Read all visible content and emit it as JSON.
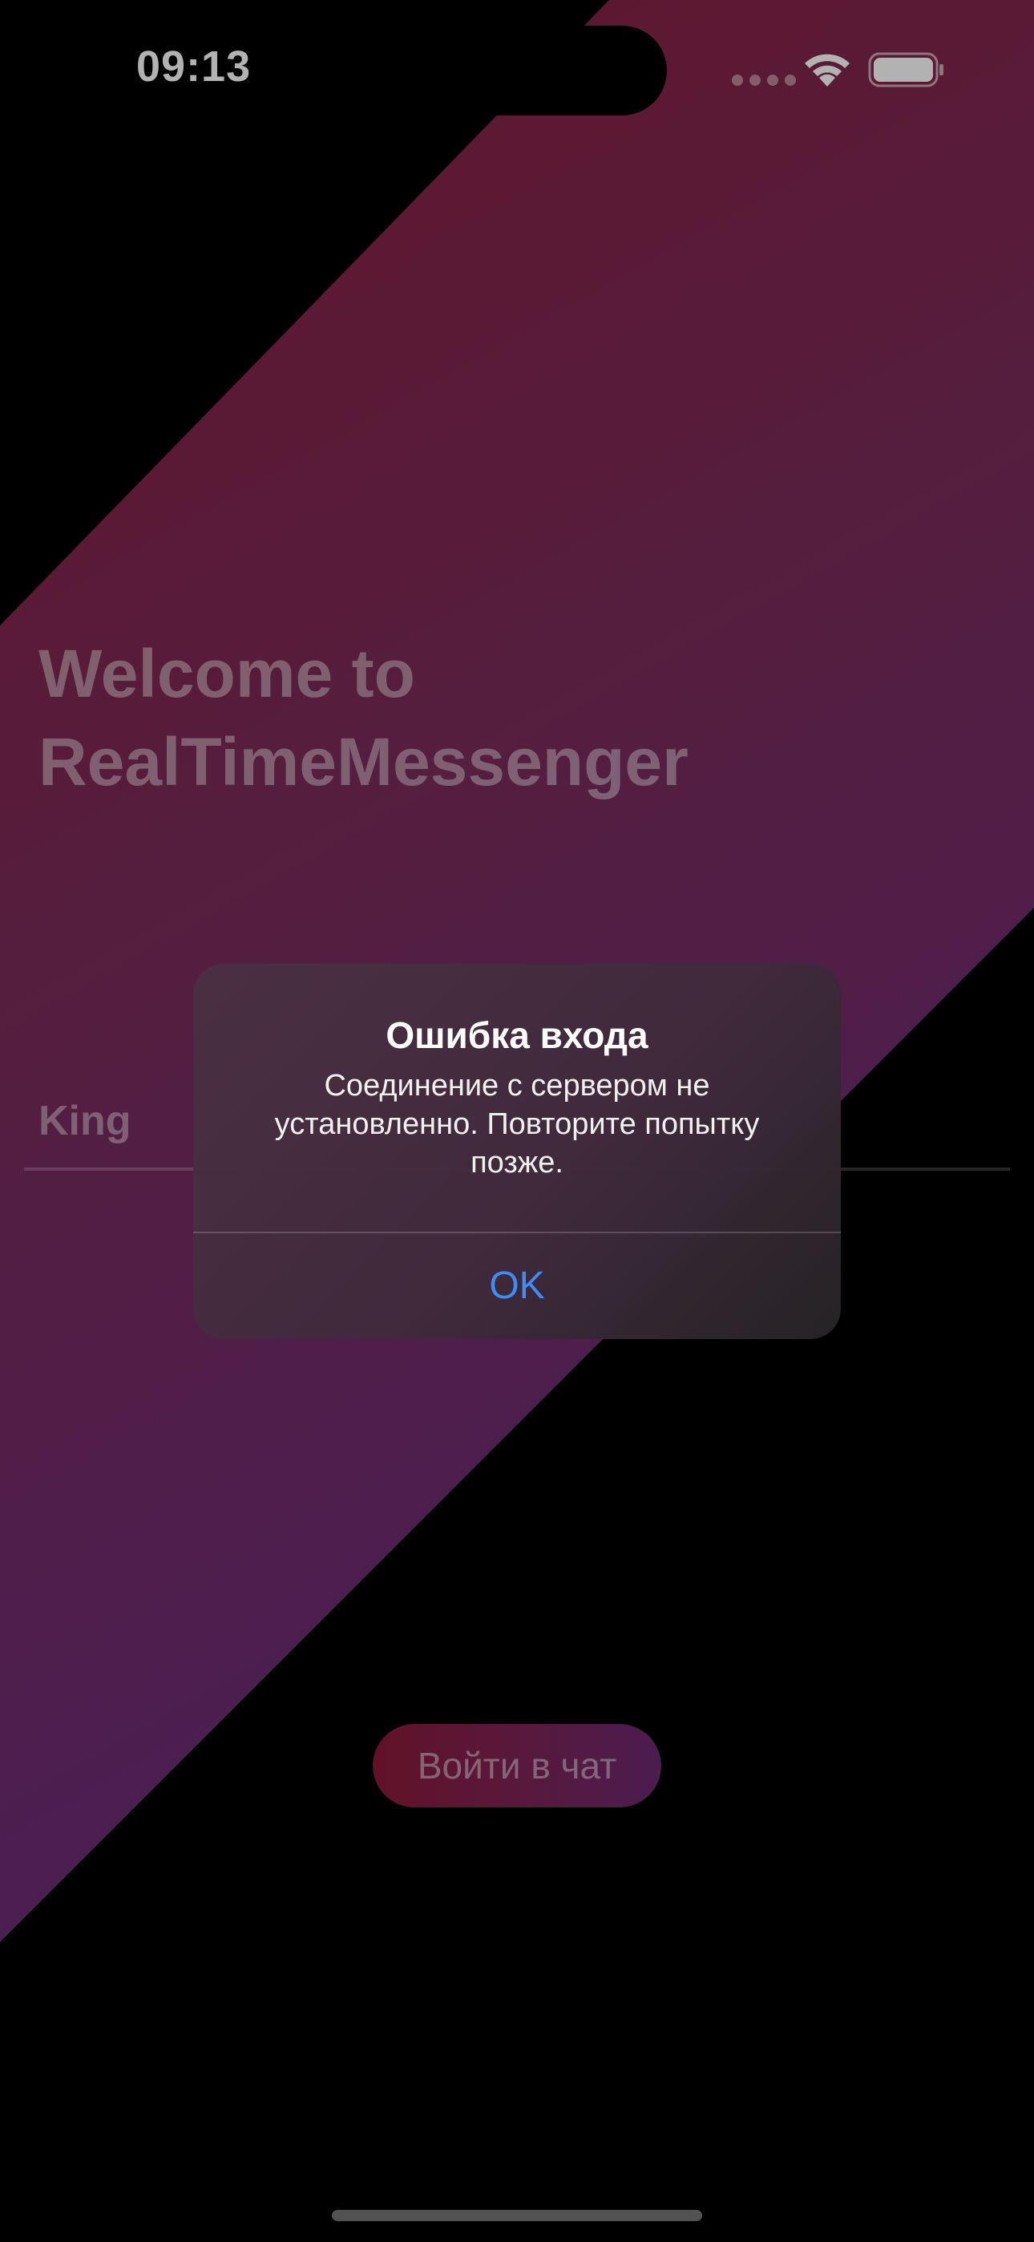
{
  "status_bar": {
    "time": "09:13"
  },
  "screen": {
    "welcome_title_line1": "Welcome to",
    "welcome_title_line2": "RealTimeMessenger",
    "username_value": "King",
    "login_button_label": "Войти в чат"
  },
  "alert": {
    "title": "Ошибка входа",
    "message": "Соединение с сервером не установленно. Повторите попытку позже.",
    "ok_label": "OK"
  },
  "colors": {
    "background": "#000000",
    "gradient_top": "#8a1f3c",
    "gradient_bottom": "#6a2c7c",
    "alert_button_blue": "#3f8cf5"
  },
  "icons": [
    "wifi-icon",
    "battery-icon",
    "cellular-signal-icon"
  ]
}
